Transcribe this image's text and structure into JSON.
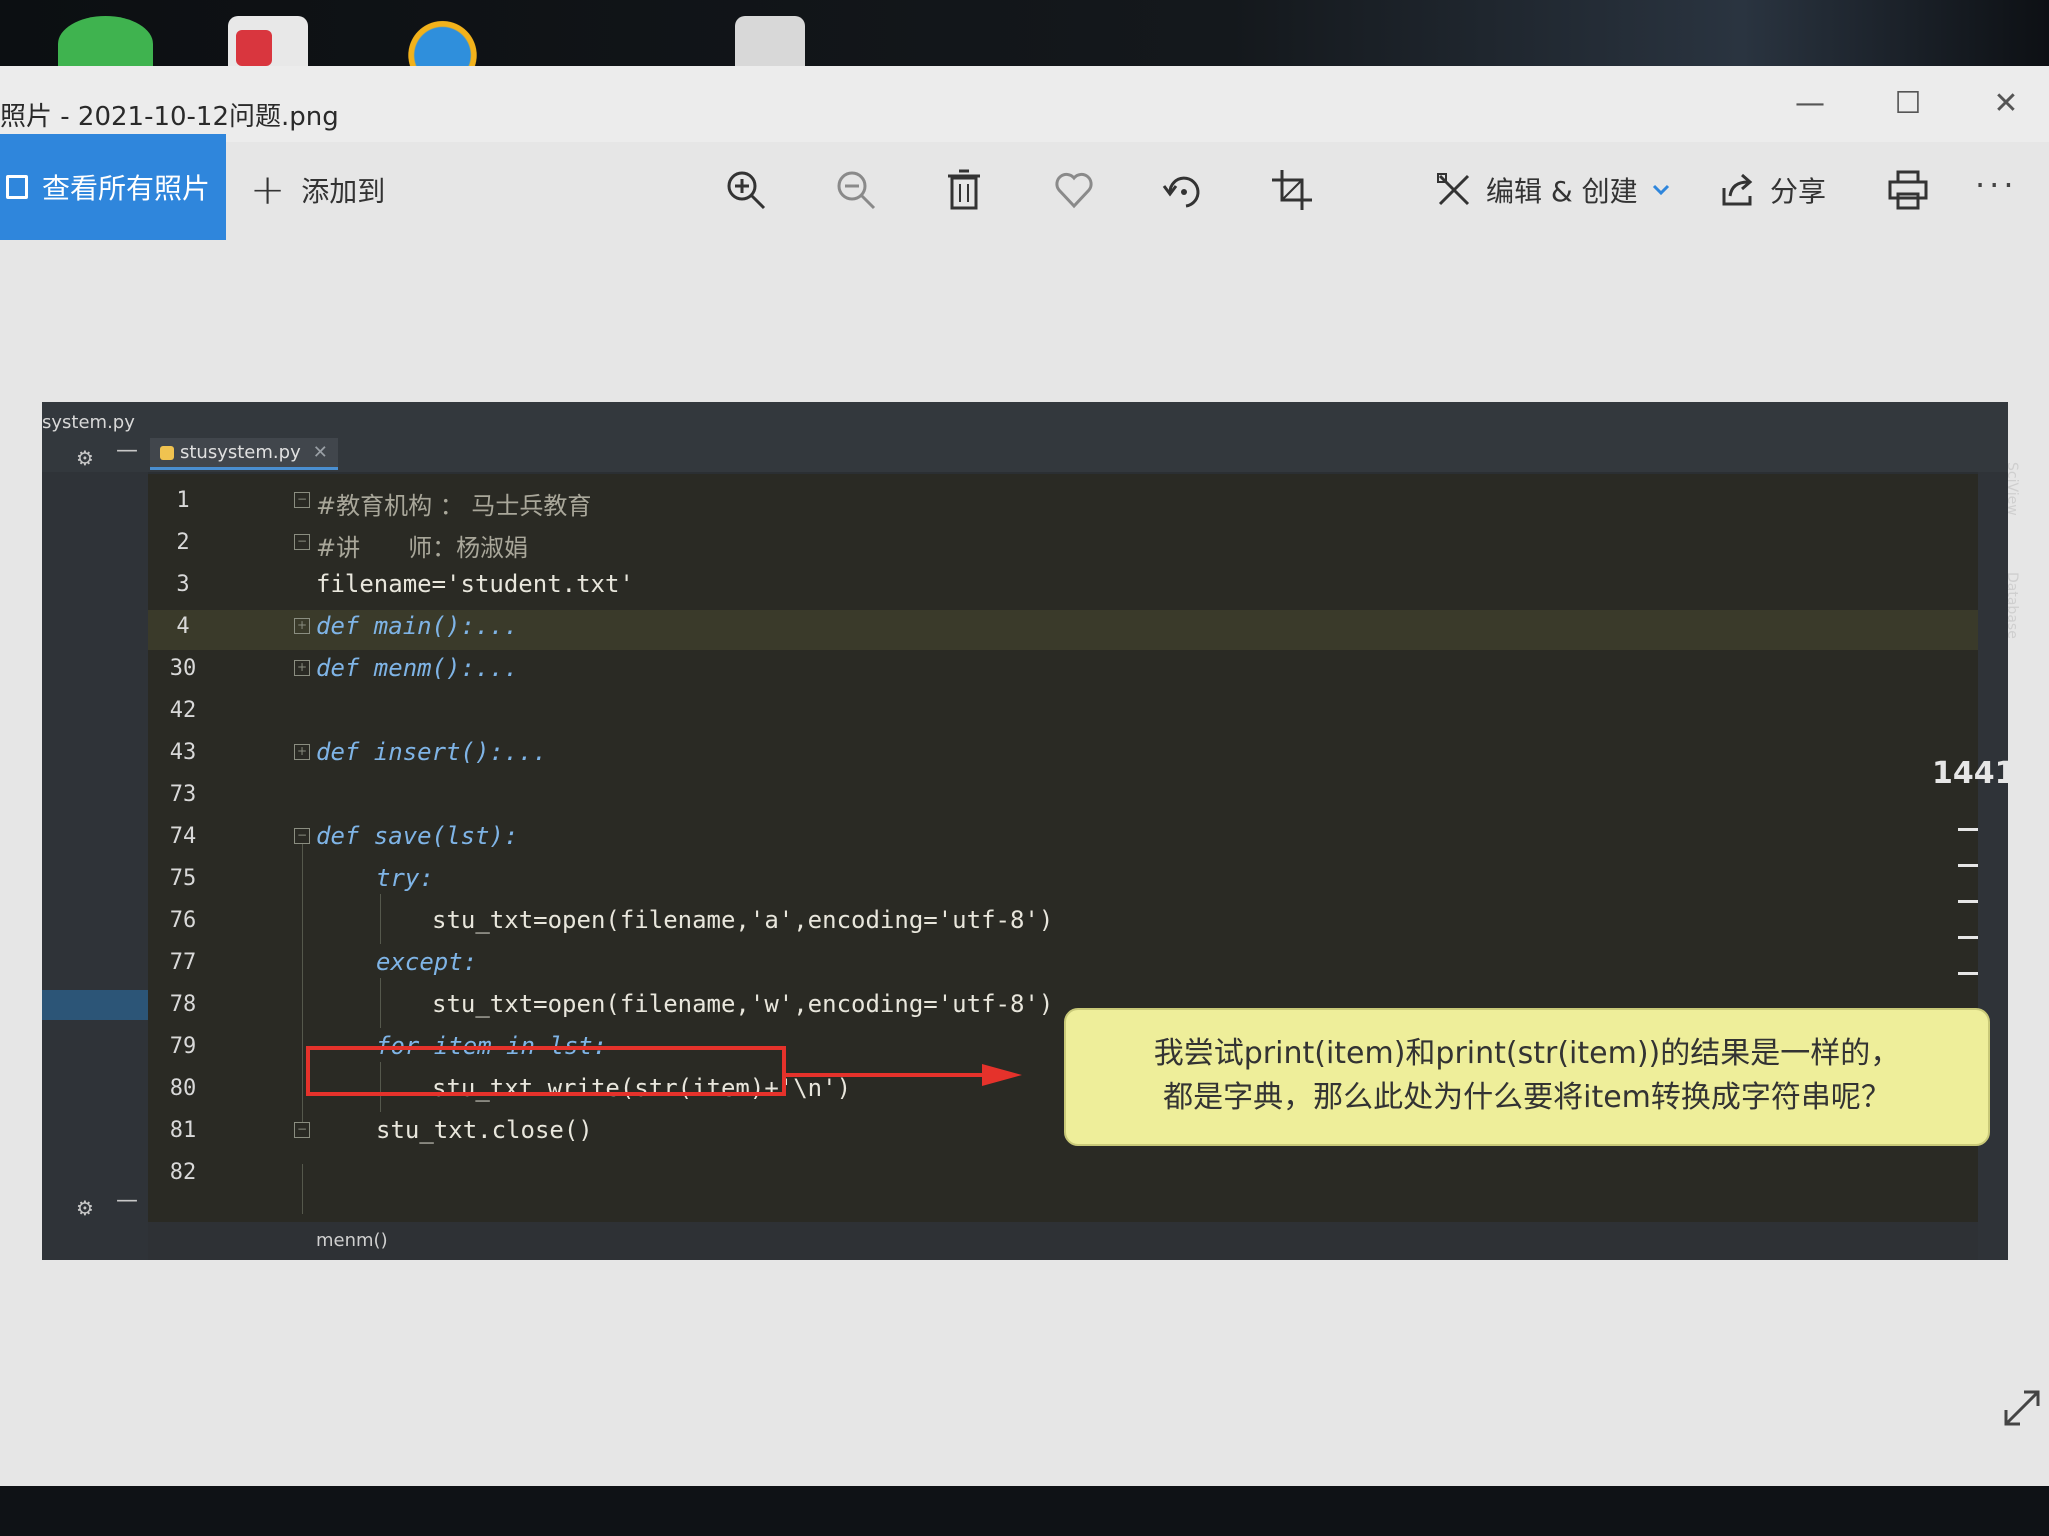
{
  "window": {
    "title": "照片 - 2021-10-12问题.png",
    "minimize": "—",
    "maximize": "☐",
    "close": "✕"
  },
  "toolbar": {
    "see_all": "查看所有照片",
    "add_to": "添加到",
    "edit_create": "编辑 & 创建",
    "share": "分享",
    "more": "···",
    "icons": [
      "zoom-in-icon",
      "zoom-out-icon",
      "trash-icon",
      "heart-icon",
      "rotate-icon",
      "crop-icon",
      "edit-create-icon",
      "chevron-down-icon",
      "share-icon",
      "print-icon"
    ]
  },
  "ide": {
    "project_file": "system.py",
    "tab_file": "stusystem.py",
    "breadcrumb": "menm()",
    "rail_labels": [
      "SciView",
      "Database"
    ],
    "rail_number": "1441",
    "code": [
      {
        "line": "1",
        "text": "#教育机构 ： 马士兵教育"
      },
      {
        "line": "2",
        "text": "#讲　　师：杨淑娟"
      },
      {
        "line": "3",
        "text": "filename='student.txt'"
      },
      {
        "line": "4",
        "text": "def main():..."
      },
      {
        "line": "30",
        "text": "def menm():..."
      },
      {
        "line": "42",
        "text": ""
      },
      {
        "line": "43",
        "text": "def insert():..."
      },
      {
        "line": "73",
        "text": ""
      },
      {
        "line": "74",
        "text": "def save(lst):"
      },
      {
        "line": "75",
        "text": "try:"
      },
      {
        "line": "76",
        "text": "stu_txt=open(filename,'a',encoding='utf-8')"
      },
      {
        "line": "77",
        "text": "except:"
      },
      {
        "line": "78",
        "text": "stu_txt=open(filename,'w',encoding='utf-8')"
      },
      {
        "line": "79",
        "text": "for item in lst:"
      },
      {
        "line": "80",
        "text": "stu_txt.write(str(item)+'\\n')"
      },
      {
        "line": "81",
        "text": "stu_txt.close()"
      },
      {
        "line": "82",
        "text": ""
      }
    ]
  },
  "annotation": {
    "line1": "我尝试print(item)和print(str(item))的结果是一样的，",
    "line2": "都是字典，那么此处为什么要将item转换成字符串呢？"
  },
  "colors": {
    "accent": "#2f86dc",
    "highlight_box": "#e5322b",
    "callout_bg": "#eeee9a"
  }
}
